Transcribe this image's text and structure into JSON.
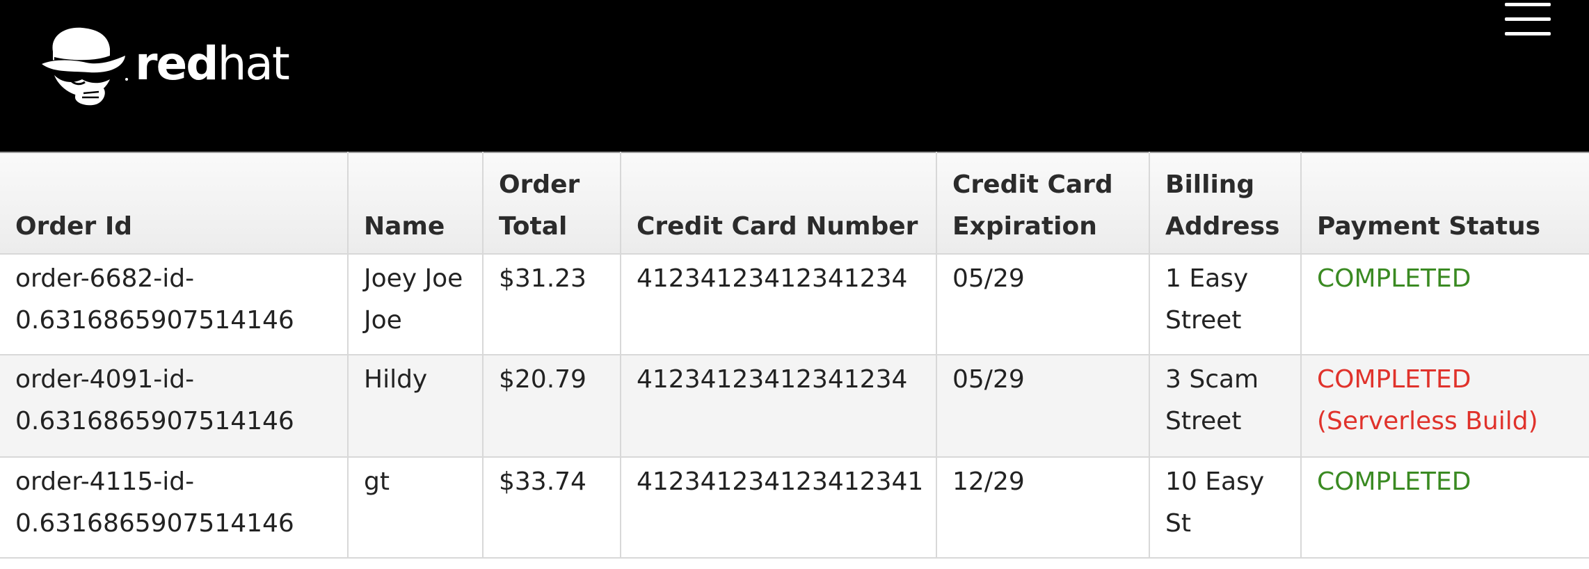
{
  "header": {
    "logo_text_red": "red",
    "logo_text_hat": "hat",
    "logo_icon": "shadowman-hat-icon",
    "menu_icon": "hamburger-menu-icon",
    "background": "#000000"
  },
  "table": {
    "columns": [
      "Order Id",
      "Name",
      "Order Total",
      "Credit Card Number",
      "Credit Card Expiration",
      "Billing Address",
      "Payment Status"
    ],
    "rows": [
      {
        "order_id": "order-6682-id-0.6316865907514146",
        "name": "Joey Joe Joe",
        "order_total": "$31.23",
        "cc_number": "41234123412341234",
        "cc_expiration": "05/29",
        "billing_address": "1 Easy Street",
        "payment_status": "COMPLETED",
        "status_color": "#3a8a22"
      },
      {
        "order_id": "order-4091-id-0.6316865907514146",
        "name": "Hildy",
        "order_total": "$20.79",
        "cc_number": "41234123412341234",
        "cc_expiration": "05/29",
        "billing_address": "3 Scam Street",
        "payment_status": "COMPLETED (Serverless Build)",
        "status_color": "#e0322b"
      },
      {
        "order_id": "order-4115-id-0.6316865907514146",
        "name": "gt",
        "order_total": "$33.74",
        "cc_number": "412341234123412341",
        "cc_expiration": "12/29",
        "billing_address": "10 Easy St",
        "payment_status": "COMPLETED",
        "status_color": "#3a8a22"
      }
    ]
  }
}
